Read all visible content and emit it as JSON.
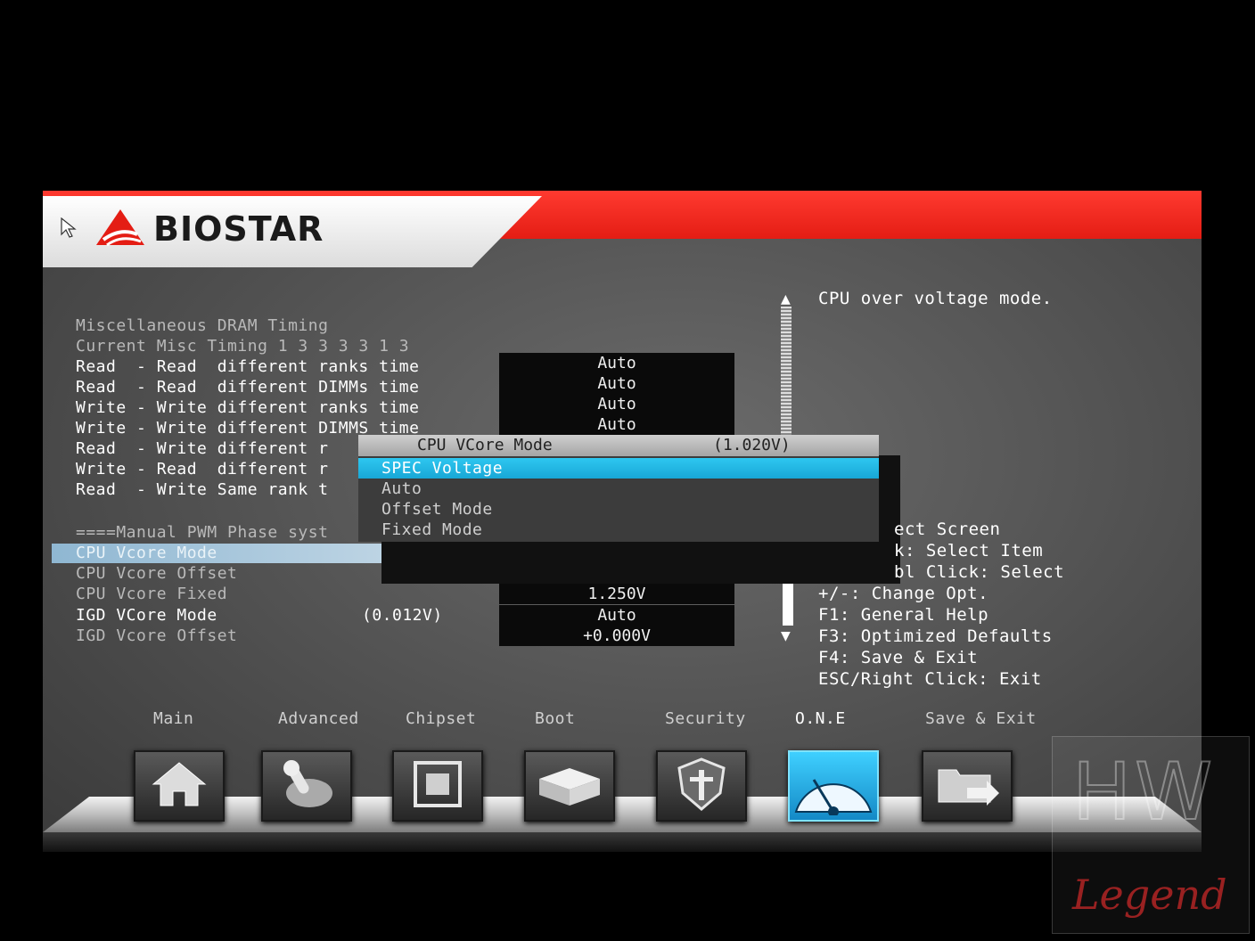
{
  "brand": {
    "name": "BIOSTAR",
    "logo_mark": "triangle-logo"
  },
  "colors": {
    "header_red": "#e41d14",
    "selection_blue": "#18a7d6",
    "help_text": "#ffffff"
  },
  "settings": [
    {
      "label": "Miscellaneous DRAM Timing",
      "value": ""
    },
    {
      "label": "Current Misc Timing 1 3 3 3 3 1 3",
      "value": ""
    },
    {
      "label": "Read  - Read  different ranks time",
      "value": "Auto"
    },
    {
      "label": "Read  - Read  different DIMMs time",
      "value": "Auto"
    },
    {
      "label": "Write - Write different ranks time",
      "value": "Auto"
    },
    {
      "label": "Write - Write different DIMMS time",
      "value": "Auto"
    },
    {
      "label": "Read  - Write different r",
      "value": ""
    },
    {
      "label": "Write - Read  different r",
      "value": ""
    },
    {
      "label": "Read  - Write Same rank t",
      "value": ""
    }
  ],
  "pwm": {
    "header": "====Manual PWM Phase syst",
    "rows": [
      {
        "label": "CPU Vcore Mode",
        "reading": "",
        "value": ""
      },
      {
        "label": "CPU Vcore Offset",
        "reading": "",
        "value": ""
      },
      {
        "label": "CPU Vcore Fixed",
        "reading": "",
        "value": "1.250V"
      },
      {
        "label": "IGD VCore Mode",
        "reading": "(0.012V)",
        "value": "Auto"
      },
      {
        "label": "IGD Vcore Offset",
        "reading": "",
        "value": "+0.000V"
      }
    ]
  },
  "popup": {
    "title": "CPU VCore Mode",
    "reading": "(1.020V)",
    "options": [
      "SPEC Voltage",
      "Auto",
      "Offset Mode",
      "Fixed Mode"
    ],
    "selected": "SPEC Voltage"
  },
  "help": {
    "description": "CPU over voltage mode.",
    "keys": [
      "ect Screen",
      "k: Select Item",
      "bl Click: Select",
      "+/-: Change Opt.",
      "F1: General Help",
      "F3: Optimized Defaults",
      "F4: Save & Exit",
      "ESC/Right Click: Exit"
    ]
  },
  "tabs": [
    {
      "label": "Main",
      "icon": "home-icon"
    },
    {
      "label": "Advanced",
      "icon": "joystick-icon"
    },
    {
      "label": "Chipset",
      "icon": "chip-icon"
    },
    {
      "label": "Boot",
      "icon": "drive-icon"
    },
    {
      "label": "Security",
      "icon": "shield-icon"
    },
    {
      "label": "O.N.E",
      "icon": "gauge-icon"
    },
    {
      "label": "Save & Exit",
      "icon": "folder-exit-icon"
    }
  ],
  "active_tab": "O.N.E",
  "watermark": {
    "top": "HW",
    "bottom": "Legend"
  }
}
